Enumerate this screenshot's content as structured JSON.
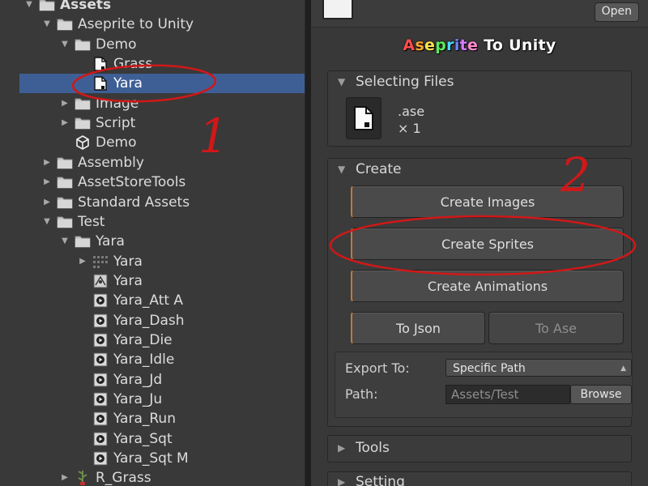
{
  "tree": {
    "items": [
      {
        "label": "Assets",
        "depth": 0,
        "arrow": "down",
        "icon": "folder",
        "bold": true,
        "selected": false
      },
      {
        "label": "Aseprite to Unity",
        "depth": 1,
        "arrow": "down",
        "icon": "folder",
        "bold": false,
        "selected": false
      },
      {
        "label": "Demo",
        "depth": 2,
        "arrow": "down",
        "icon": "folder",
        "bold": false,
        "selected": false
      },
      {
        "label": "Grass",
        "depth": 3,
        "arrow": "none",
        "icon": "file",
        "bold": false,
        "selected": false
      },
      {
        "label": "Yara",
        "depth": 3,
        "arrow": "none",
        "icon": "file",
        "bold": false,
        "selected": true
      },
      {
        "label": "Image",
        "depth": 2,
        "arrow": "right",
        "icon": "folder",
        "bold": false,
        "selected": false
      },
      {
        "label": "Script",
        "depth": 2,
        "arrow": "right",
        "icon": "folder",
        "bold": false,
        "selected": false
      },
      {
        "label": "Demo",
        "depth": 2,
        "arrow": "none",
        "icon": "unity",
        "bold": false,
        "selected": false
      },
      {
        "label": "Assembly",
        "depth": 1,
        "arrow": "right",
        "icon": "folder",
        "bold": false,
        "selected": false
      },
      {
        "label": "AssetStoreTools",
        "depth": 1,
        "arrow": "right",
        "icon": "folder",
        "bold": false,
        "selected": false
      },
      {
        "label": "Standard Assets",
        "depth": 1,
        "arrow": "right",
        "icon": "folder",
        "bold": false,
        "selected": false
      },
      {
        "label": "Test",
        "depth": 1,
        "arrow": "down",
        "icon": "folder",
        "bold": false,
        "selected": false
      },
      {
        "label": "Yara",
        "depth": 2,
        "arrow": "down",
        "icon": "folder",
        "bold": false,
        "selected": false
      },
      {
        "label": "Yara",
        "depth": 3,
        "arrow": "right",
        "icon": "sprite-sheet",
        "bold": false,
        "selected": false
      },
      {
        "label": "Yara",
        "depth": 3,
        "arrow": "none",
        "icon": "anim-controller",
        "bold": false,
        "selected": false
      },
      {
        "label": "Yara_Att A",
        "depth": 3,
        "arrow": "none",
        "icon": "anim-clip",
        "bold": false,
        "selected": false
      },
      {
        "label": "Yara_Dash",
        "depth": 3,
        "arrow": "none",
        "icon": "anim-clip",
        "bold": false,
        "selected": false
      },
      {
        "label": "Yara_Die",
        "depth": 3,
        "arrow": "none",
        "icon": "anim-clip",
        "bold": false,
        "selected": false
      },
      {
        "label": "Yara_Idle",
        "depth": 3,
        "arrow": "none",
        "icon": "anim-clip",
        "bold": false,
        "selected": false
      },
      {
        "label": "Yara_Jd",
        "depth": 3,
        "arrow": "none",
        "icon": "anim-clip",
        "bold": false,
        "selected": false
      },
      {
        "label": "Yara_Ju",
        "depth": 3,
        "arrow": "none",
        "icon": "anim-clip",
        "bold": false,
        "selected": false
      },
      {
        "label": "Yara_Run",
        "depth": 3,
        "arrow": "none",
        "icon": "anim-clip",
        "bold": false,
        "selected": false
      },
      {
        "label": "Yara_Sqt",
        "depth": 3,
        "arrow": "none",
        "icon": "anim-clip",
        "bold": false,
        "selected": false
      },
      {
        "label": "Yara_Sqt M",
        "depth": 3,
        "arrow": "none",
        "icon": "anim-clip",
        "bold": false,
        "selected": false
      },
      {
        "label": "R_Grass",
        "depth": 2,
        "arrow": "right",
        "icon": "prefab",
        "bold": false,
        "selected": false
      }
    ]
  },
  "inspector": {
    "open_label": "Open",
    "title_chars": [
      "A",
      "s",
      "e",
      "p",
      "r",
      "i",
      "t",
      "e"
    ],
    "title_rest": " To Unity",
    "selecting": {
      "header": "Selecting Files",
      "ext": ".ase",
      "count": "× 1"
    },
    "create": {
      "header": "Create",
      "create_images": "Create Images",
      "create_sprites": "Create Sprites",
      "create_animations": "Create Animations",
      "to_json": "To Json",
      "to_ase": "To Ase",
      "export_to_label": "Export To:",
      "export_to_value": "Specific Path",
      "path_label": "Path:",
      "path_value": "Assets/Test",
      "browse": "Browse"
    },
    "tools_header": "Tools",
    "setting_header": "Setting"
  },
  "annotations": {
    "num1": "1",
    "num2": "2",
    "color": "#d01818"
  },
  "colors": {
    "selection": "#3e5f96",
    "panel": "#383838",
    "accent_orange": "#c07a3a"
  }
}
